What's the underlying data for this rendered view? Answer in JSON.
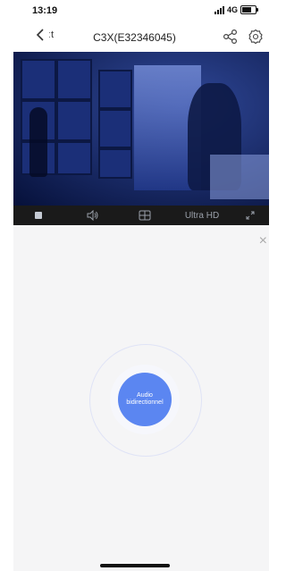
{
  "status_bar": {
    "time": "13:19",
    "network": "4G"
  },
  "nav": {
    "back_label": "ːt",
    "title": "C3X(E32346045)"
  },
  "controls": {
    "quality": "Ultra HD"
  },
  "panel": {
    "close_symbol": "×",
    "audio_label": "Audio bidirectionnel"
  },
  "colors": {
    "accent": "#5b86f1",
    "video_bg": "#0f1f54",
    "control_bar": "#1a1a1a",
    "panel_bg": "#f5f5f6"
  },
  "icons": [
    "back-chevron-icon",
    "share-icon",
    "settings-icon",
    "stop-icon",
    "speaker-icon",
    "split-view-icon",
    "fullscreen-icon",
    "close-icon"
  ]
}
